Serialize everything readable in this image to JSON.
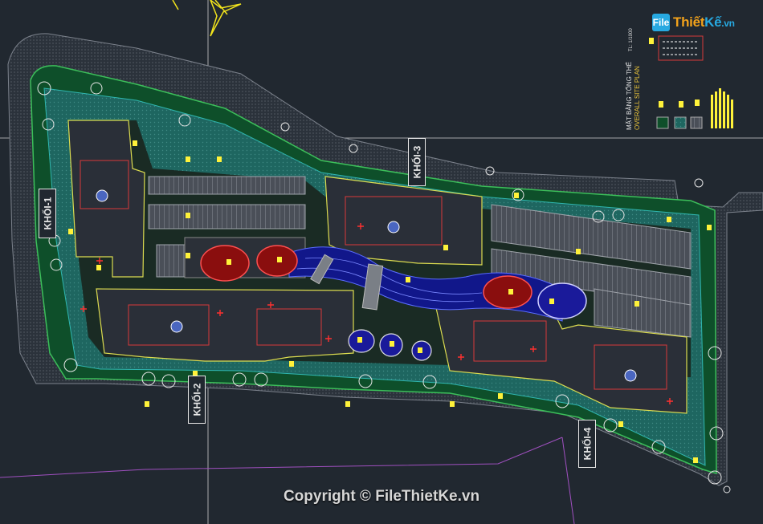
{
  "watermark": {
    "logo_file": "File",
    "logo_thiet": "Thiết",
    "logo_ke": "Kế",
    "logo_domain": ".vn",
    "copyright": "Copyright © FileThietKe.vn"
  },
  "blocks": {
    "k1": "KHỐI-1",
    "k2": "KHỐI-2",
    "k3": "KHỐI-3",
    "k4": "KHỐI-4"
  },
  "drawing_title": {
    "line1": "MẶT BẰNG TỔNG THỂ",
    "line2": "OVERALL SITE PLAN",
    "scale": "TL: 1/1000"
  },
  "colors": {
    "background": "#212830",
    "grass": "#0e4f2a",
    "paving": "#1f6a64",
    "building": "#2a2f38",
    "water_blue": "#1a1a9a",
    "water_red": "#8a0e0e",
    "yellow_marks": "#fff23a"
  }
}
